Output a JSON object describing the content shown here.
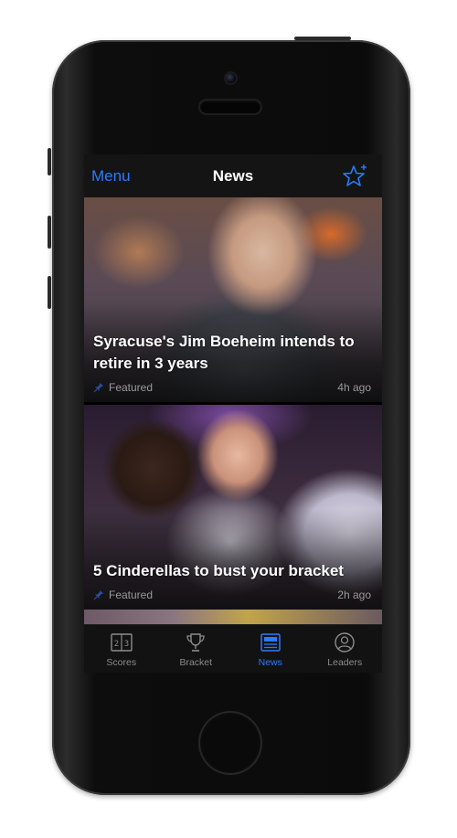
{
  "navbar": {
    "menu_label": "Menu",
    "title": "News",
    "favorite_icon": "star-plus-icon"
  },
  "articles": [
    {
      "headline": "Syracuse's Jim Boeheim intends to retire in 3 years",
      "tag": "Featured",
      "time": "4h ago"
    },
    {
      "headline": "5 Cinderellas to bust your bracket",
      "tag": "Featured",
      "time": "2h ago"
    }
  ],
  "tabs": [
    {
      "label": "Scores",
      "icon": "scoreboard-icon",
      "active": false
    },
    {
      "label": "Bracket",
      "icon": "trophy-icon",
      "active": false
    },
    {
      "label": "News",
      "icon": "newspaper-icon",
      "active": true
    },
    {
      "label": "Leaders",
      "icon": "person-icon",
      "active": false
    }
  ],
  "colors": {
    "accent": "#2a7bff",
    "inactive": "#8c8c8c",
    "bar_background": "#141414"
  }
}
